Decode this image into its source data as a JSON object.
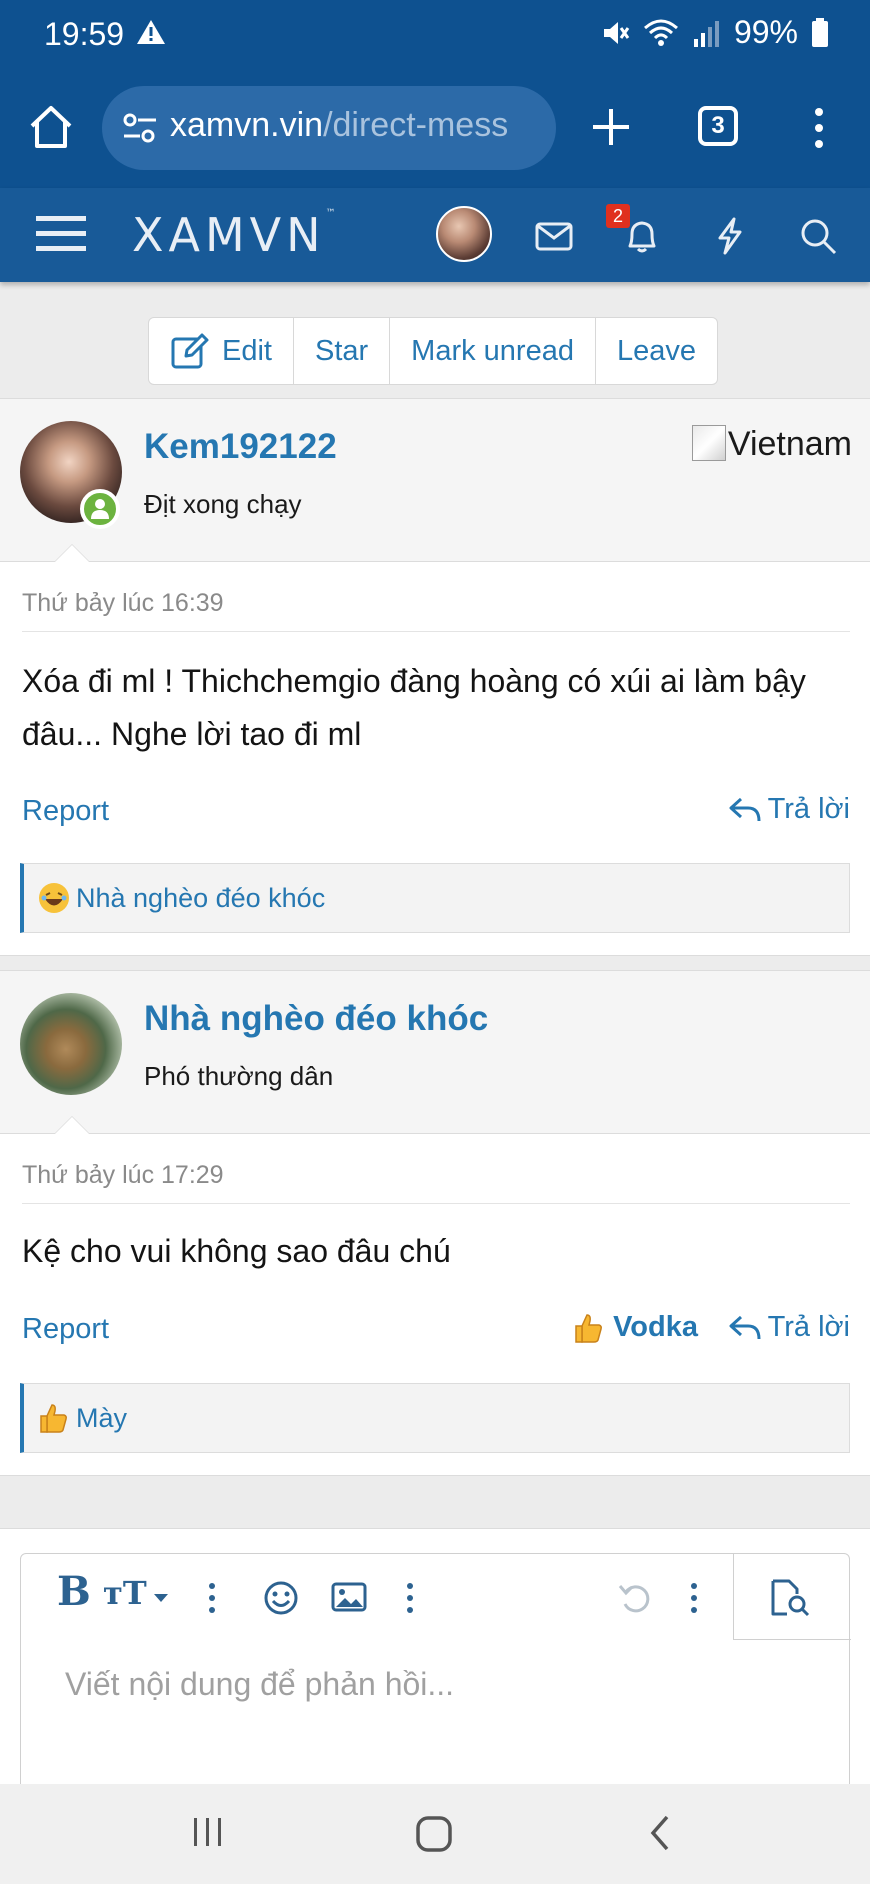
{
  "status_bar": {
    "time": "19:59",
    "battery": "99%",
    "icons": [
      "warning-icon",
      "mute-icon",
      "wifi-icon",
      "signal-icon",
      "battery-icon"
    ]
  },
  "browser": {
    "url_host": "xamvn.vin",
    "url_path": "/direct-mess",
    "tab_count": "3"
  },
  "site": {
    "logo": "XAMVN",
    "logo_tm": "™",
    "notification_count": "2"
  },
  "conversation_actions": [
    "Edit",
    "Star",
    "Mark unread",
    "Leave"
  ],
  "messages": [
    {
      "username": "Kem192122",
      "user_title": "Địt xong chạy",
      "flag_alt": "Vietnam",
      "date": "Thứ bảy lúc 16:39",
      "body": "Xóa đi ml ! Thichchemgio đàng hoàng có xúi ai làm bậy đâu... Nghe lời tao đi ml",
      "report_label": "Report",
      "reply_label": "Trả lời",
      "reaction_by": "Nhà nghèo đéo khóc",
      "reaction_icon": "laugh-emoji"
    },
    {
      "username": "Nhà nghèo đéo khóc",
      "user_title": "Phó thường dân",
      "date": "Thứ bảy lúc 17:29",
      "body": "Kệ cho vui không sao đâu chú",
      "report_label": "Report",
      "like_label": "Vodka",
      "reply_label": "Trả lời",
      "reaction_by": "Mày",
      "reaction_icon": "thumbs-up-emoji"
    }
  ],
  "editor": {
    "bold_label": "B",
    "text_size_label": "тT",
    "placeholder": "Viết nội dung để phản hồi..."
  },
  "colors": {
    "header_bg": "#0e5190",
    "site_header_bg": "#185a98",
    "link": "#2577b1",
    "online": "#6cb33f",
    "badge": "#e0301e"
  }
}
